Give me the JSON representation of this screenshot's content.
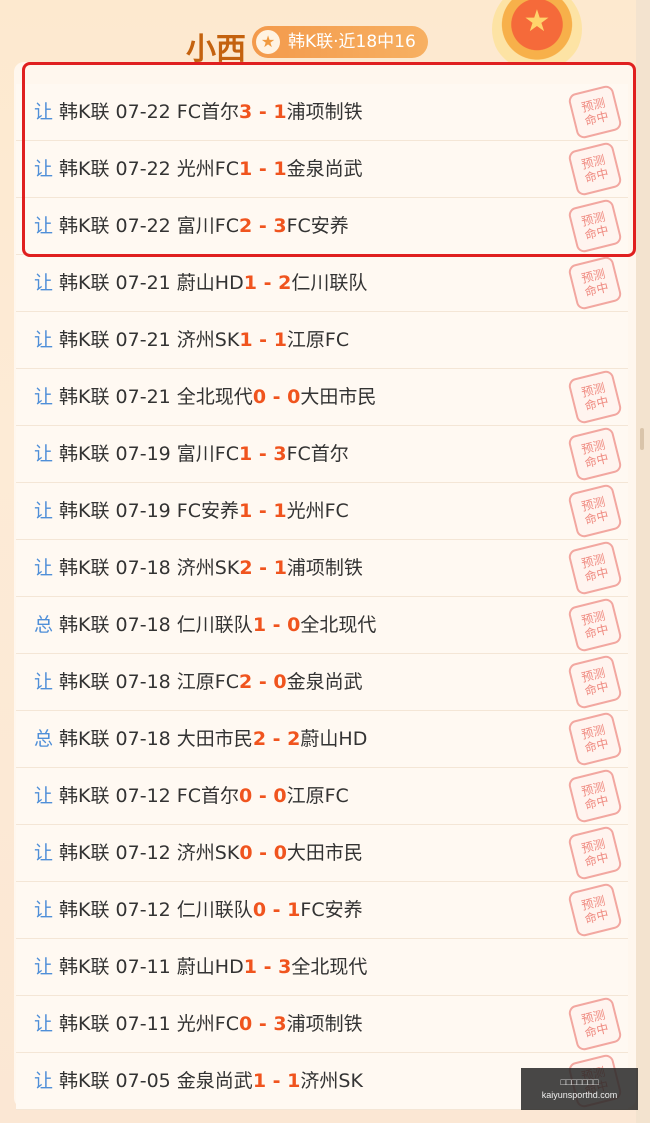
{
  "header": {
    "name": "小西",
    "badge": "韩K联·近18中16"
  },
  "stamp_text": [
    "预测",
    "命中"
  ],
  "watermark": {
    "line1": "□□□□□□□",
    "line2": "kaiyunsporthd.com"
  },
  "rows": [
    {
      "type": "让",
      "league": "韩K联",
      "date": "07-22",
      "home": "FC首尔",
      "home_score": "3",
      "sep": " - ",
      "away_score": "1",
      "away": "浦项制铁",
      "hit": true
    },
    {
      "type": "让",
      "league": "韩K联",
      "date": "07-22",
      "home": "光州FC",
      "home_score": "1",
      "sep": " - ",
      "away_score": "1",
      "away": "金泉尚武",
      "hit": true
    },
    {
      "type": "让",
      "league": "韩K联",
      "date": "07-22",
      "home": "富川FC",
      "home_score": "2",
      "sep": " - ",
      "away_score": "3",
      "away": "FC安养",
      "hit": true
    },
    {
      "type": "让",
      "league": "韩K联",
      "date": "07-21",
      "home": "蔚山HD",
      "home_score": "1",
      "sep": " - ",
      "away_score": "2",
      "away": "仁川联队",
      "hit": true
    },
    {
      "type": "让",
      "league": "韩K联",
      "date": "07-21",
      "home": "济州SK",
      "home_score": "1",
      "sep": " - ",
      "away_score": "1",
      "away": "江原FC",
      "hit": false
    },
    {
      "type": "让",
      "league": "韩K联",
      "date": "07-21",
      "home": "全北现代",
      "home_score": "0",
      "sep": " - ",
      "away_score": "0",
      "away": "大田市民",
      "hit": true
    },
    {
      "type": "让",
      "league": "韩K联",
      "date": "07-19",
      "home": "富川FC",
      "home_score": "1",
      "sep": " - ",
      "away_score": "3",
      "away": "FC首尔",
      "hit": true
    },
    {
      "type": "让",
      "league": "韩K联",
      "date": "07-19",
      "home": "FC安养",
      "home_score": "1",
      "sep": " - ",
      "away_score": "1",
      "away": "光州FC",
      "hit": true
    },
    {
      "type": "让",
      "league": "韩K联",
      "date": "07-18",
      "home": "济州SK",
      "home_score": "2",
      "sep": " - ",
      "away_score": "1",
      "away": "浦项制铁",
      "hit": true
    },
    {
      "type": "总",
      "league": "韩K联",
      "date": "07-18",
      "home": "仁川联队",
      "home_score": "1",
      "sep": " - ",
      "away_score": "0",
      "away": "全北现代",
      "hit": true
    },
    {
      "type": "让",
      "league": "韩K联",
      "date": "07-18",
      "home": "江原FC",
      "home_score": "2",
      "sep": " - ",
      "away_score": "0",
      "away": "金泉尚武",
      "hit": true
    },
    {
      "type": "总",
      "league": "韩K联",
      "date": "07-18",
      "home": "大田市民",
      "home_score": "2",
      "sep": " - ",
      "away_score": "2",
      "away": "蔚山HD",
      "hit": true
    },
    {
      "type": "让",
      "league": "韩K联",
      "date": "07-12",
      "home": "FC首尔",
      "home_score": "0",
      "sep": " - ",
      "away_score": "0",
      "away": "江原FC",
      "hit": true
    },
    {
      "type": "让",
      "league": "韩K联",
      "date": "07-12",
      "home": "济州SK",
      "home_score": "0",
      "sep": " - ",
      "away_score": "0",
      "away": "大田市民",
      "hit": true
    },
    {
      "type": "让",
      "league": "韩K联",
      "date": "07-12",
      "home": "仁川联队",
      "home_score": "0",
      "sep": " - ",
      "away_score": "1",
      "away": "FC安养",
      "hit": true
    },
    {
      "type": "让",
      "league": "韩K联",
      "date": "07-11",
      "home": "蔚山HD",
      "home_score": "1",
      "sep": " - ",
      "away_score": "3",
      "away": "全北现代",
      "hit": false
    },
    {
      "type": "让",
      "league": "韩K联",
      "date": "07-11",
      "home": "光州FC",
      "home_score": "0",
      "sep": " - ",
      "away_score": "3",
      "away": "浦项制铁",
      "hit": true
    },
    {
      "type": "让",
      "league": "韩K联",
      "date": "07-05",
      "home": "金泉尚武",
      "home_score": "1",
      "sep": " - ",
      "away_score": "1",
      "away": "济州SK",
      "hit": true
    }
  ]
}
